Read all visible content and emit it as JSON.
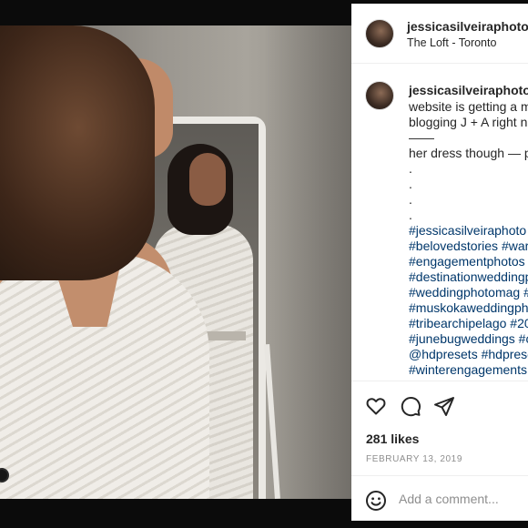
{
  "post": {
    "username": "jessicasilveiraphoto",
    "location": "The Loft - Toronto"
  },
  "caption": {
    "username": "jessicasilveiraphoto",
    "lines": [
      "website is getting a m",
      "blogging J + A right n",
      "——",
      "her dress though — p",
      ".",
      ".",
      ".",
      "."
    ],
    "hashtags": [
      "#jessicasilveiraphoto",
      "#belovedstories #war",
      "#engagementphotos",
      "#destinationweddingp",
      "#weddingphotomag #",
      "#muskokaweddingph",
      "#tribearchipelago #20",
      "#junebugweddings #c",
      "@hdpresets #hdprese",
      "#winterengagements"
    ]
  },
  "actions": {
    "like_icon": "heart-icon",
    "comment_icon": "comment-bubble-icon",
    "share_icon": "paper-plane-icon"
  },
  "likes": "281 likes",
  "date": "FEBRUARY 13, 2019",
  "comment": {
    "placeholder": "Add a comment...",
    "emoji_icon": "smiley-icon"
  },
  "colors": {
    "hashtag": "#00376b",
    "text": "#262626",
    "muted": "#8e8e8e",
    "backdrop": "#0b0b0b"
  }
}
